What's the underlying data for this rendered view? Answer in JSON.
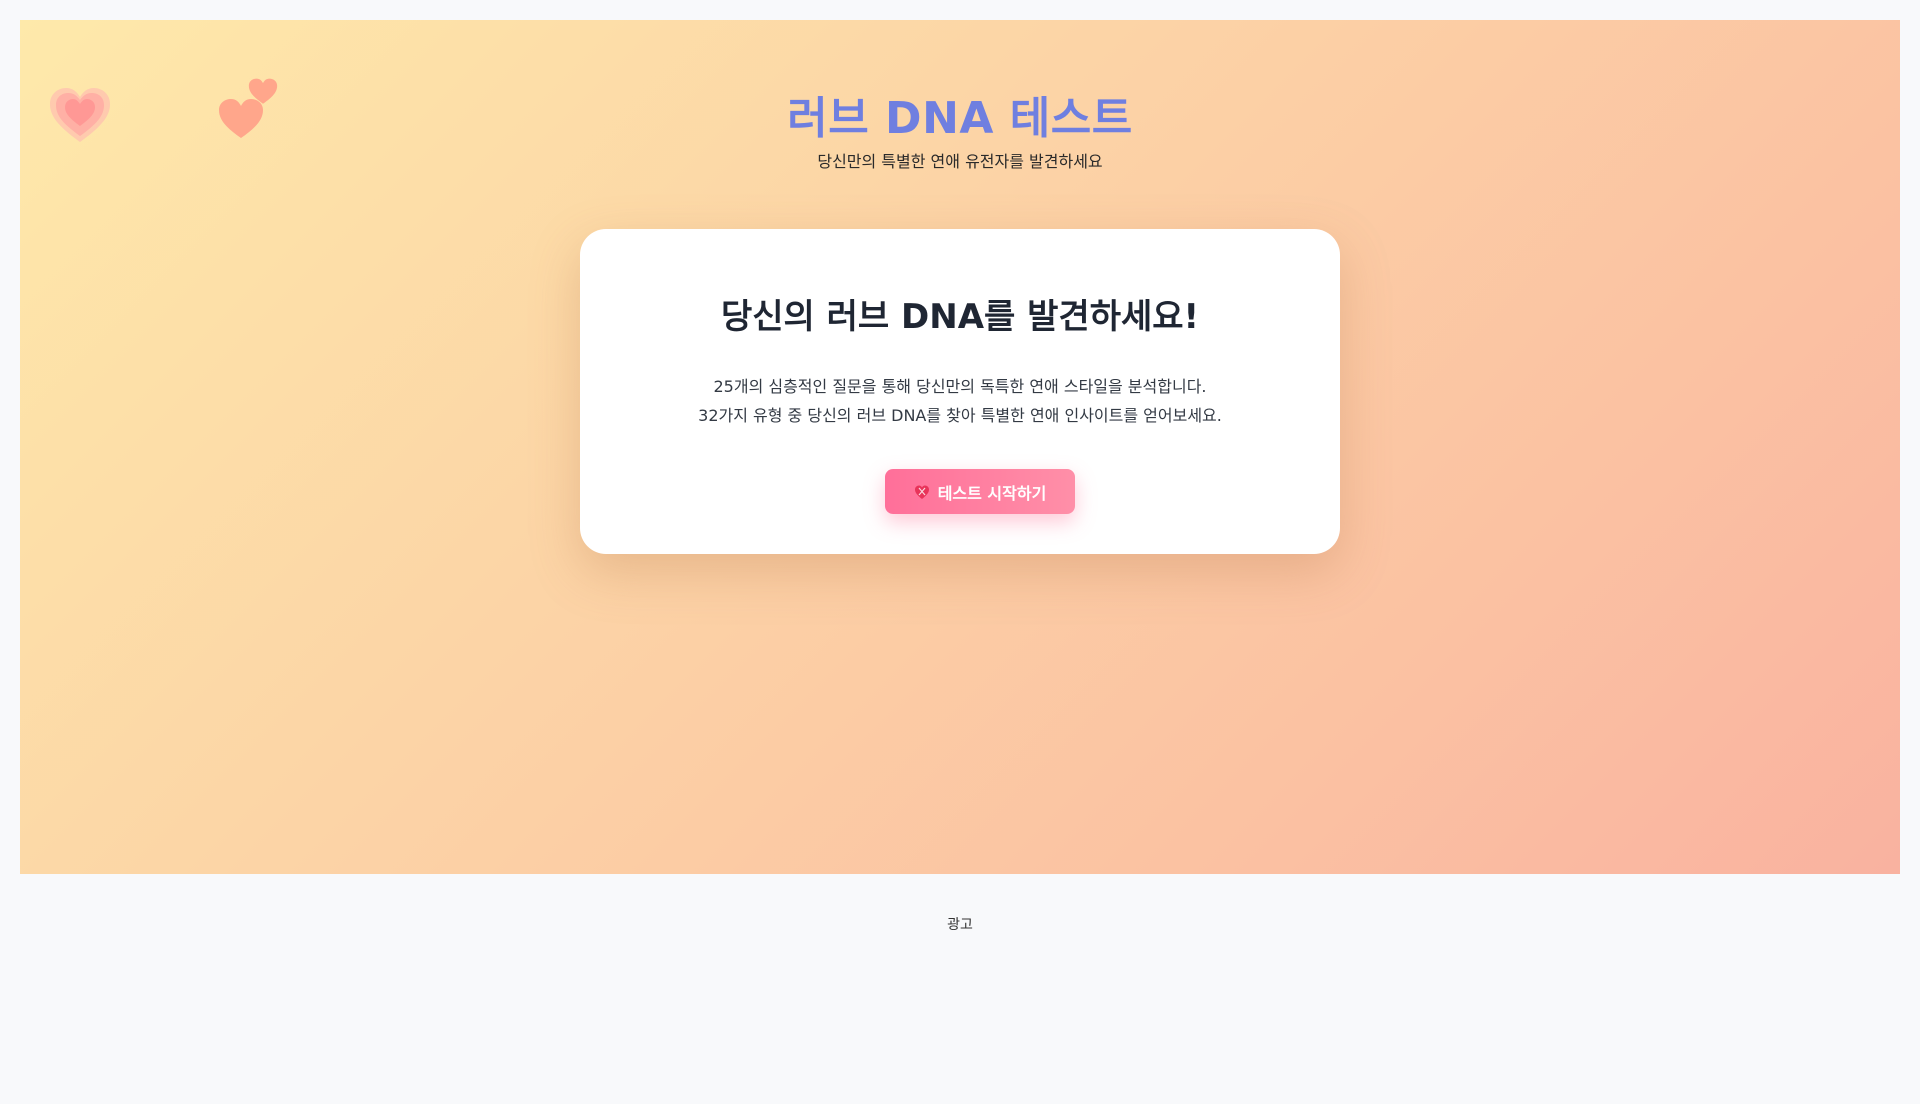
{
  "header": {
    "title": "러브 DNA 테스트",
    "subtitle": "당신만의 특별한 연애 유전자를 발견하세요"
  },
  "card": {
    "title": "당신의 러브 DNA를 발견하세요!",
    "description_line1": "25개의 심층적인 질문을 통해 당신만의 독특한 연애 스타일을 분석합니다.",
    "description_line2": "32가지 유형 중 당신의 러브 DNA를 찾아 특별한 연애 인사이트를 얻어보세요.",
    "start_button_label": "테스트 시작하기",
    "start_button_icon": "heart-dna-icon"
  },
  "decorations": {
    "hearts": [
      "heart-icon",
      "heart-icon",
      "heart-icon"
    ]
  },
  "ad": {
    "label": "광고"
  },
  "colors": {
    "title": "#6f7fe0",
    "button": "#ff6f99",
    "gradient_start": "#fee9aa",
    "gradient_end": "#f9b2a0"
  }
}
